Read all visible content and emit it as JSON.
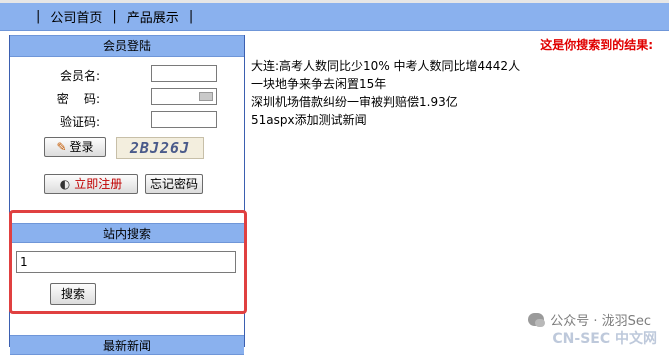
{
  "nav": {
    "sep": "|",
    "items": [
      {
        "label": "公司首页"
      },
      {
        "label": "产品展示"
      }
    ]
  },
  "login": {
    "title": "会员登陆",
    "username_label": "会员名:",
    "password_label": "密    码:",
    "captcha_label": "验证码:",
    "username_value": "",
    "password_value": "",
    "captcha_value": "",
    "login_button": "登录",
    "captcha_text": "2BJ26J",
    "register_button": "立即注册",
    "forgot_button": "忘记密码"
  },
  "site_search": {
    "title": "站内搜索",
    "input_value": "1",
    "button": "搜索"
  },
  "news_box": {
    "title": "最新新闻"
  },
  "results": {
    "header": "这是你搜索到的结果:",
    "items": [
      "大连:高考人数同比少10% 中考人数同比增4442人",
      "一块地争来争去闲置15年",
      "深圳机场借款纠纷一审被判赔偿1.93亿",
      "51aspx添加测试新闻"
    ]
  },
  "watermark": {
    "text": "公众号 · 泷羽Sec",
    "text2": "CN-SEC 中文网"
  },
  "colors": {
    "nav_bg": "#8ab1ee",
    "highlight": "#e04040",
    "result_header": "#e00000"
  }
}
